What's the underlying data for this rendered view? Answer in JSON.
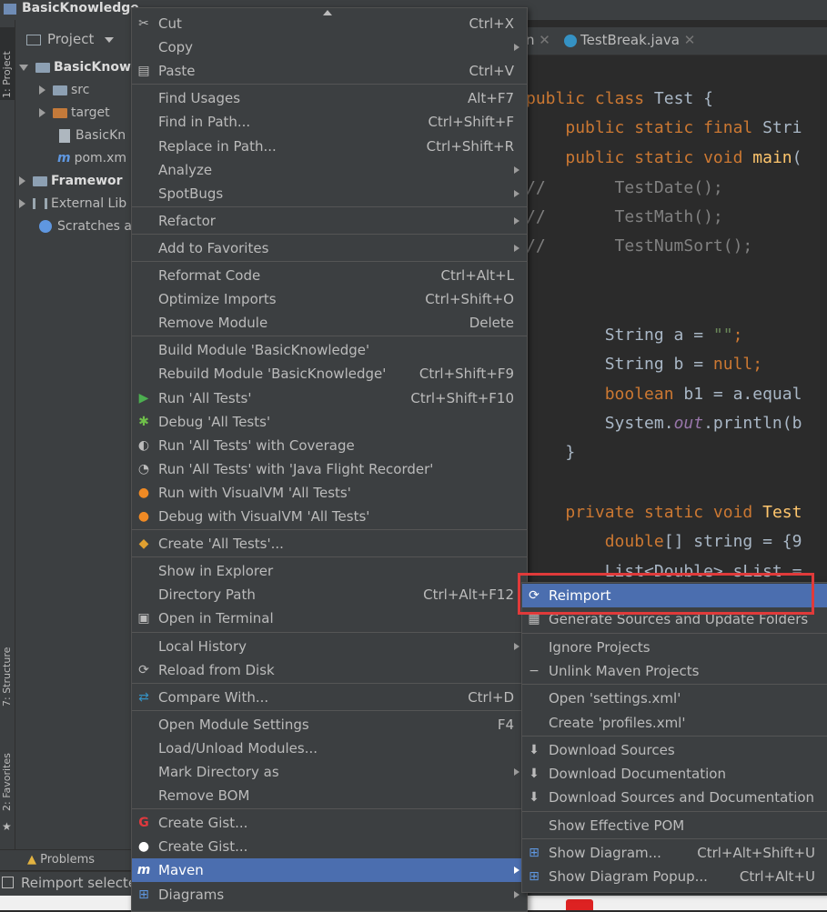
{
  "window": {
    "title": "BasicKnowledge"
  },
  "side_tabs": {
    "project": "1: Project",
    "structure": "7: Structure",
    "favorites": "2: Favorites"
  },
  "project_panel": {
    "header": "Project",
    "tree": [
      {
        "label": "BasicKnow",
        "level": 0,
        "expanded": true,
        "bold": true,
        "icon": "module-folder-icon"
      },
      {
        "label": "src",
        "level": 1,
        "icon": "folder-icon"
      },
      {
        "label": "target",
        "level": 1,
        "icon": "folder-orange-icon"
      },
      {
        "label": "BasicKn",
        "level": 1,
        "icon": "iml-file-icon"
      },
      {
        "label": "pom.xm",
        "level": 1,
        "icon": "maven-file-icon"
      },
      {
        "label": "Framewor",
        "level": 0,
        "bold": true,
        "icon": "module-folder-icon"
      },
      {
        "label": "External Lib",
        "level": 0,
        "icon": "libraries-icon"
      },
      {
        "label": "Scratches a",
        "level": 0,
        "icon": "scratches-icon"
      }
    ]
  },
  "editor": {
    "tabs": [
      {
        "label": "n"
      },
      {
        "label": "TestBreak.java"
      }
    ],
    "code": [
      "public class Test {",
      "    public static final Stri",
      "    public static void main(",
      "//       TestDate();",
      "//       TestMath();",
      "//       TestNumSort();",
      "",
      "",
      "        String a = \"\";",
      "        String b = null;",
      "        boolean b1 = a.equal",
      "        System.out.println(b",
      "    }",
      "",
      "    private static void Test",
      "        double[] string = {9",
      "        List<Double> sList ="
    ]
  },
  "bottom_tool": {
    "problems": "Problems"
  },
  "status_text": "Reimport selecte",
  "context_menu": {
    "items": [
      {
        "label": "Cut",
        "shortcut": "Ctrl+X",
        "icon": "scissors-icon"
      },
      {
        "label": "Copy",
        "submenu": true
      },
      {
        "label": "Paste",
        "shortcut": "Ctrl+V",
        "icon": "clipboard-icon"
      },
      {
        "sep": true
      },
      {
        "label": "Find Usages",
        "shortcut": "Alt+F7"
      },
      {
        "label": "Find in Path...",
        "shortcut": "Ctrl+Shift+F"
      },
      {
        "label": "Replace in Path...",
        "shortcut": "Ctrl+Shift+R"
      },
      {
        "label": "Analyze",
        "submenu": true
      },
      {
        "label": "SpotBugs",
        "submenu": true
      },
      {
        "sep": true
      },
      {
        "label": "Refactor",
        "submenu": true
      },
      {
        "sep": true
      },
      {
        "label": "Add to Favorites",
        "submenu": true
      },
      {
        "sep": true
      },
      {
        "label": "Reformat Code",
        "shortcut": "Ctrl+Alt+L"
      },
      {
        "label": "Optimize Imports",
        "shortcut": "Ctrl+Shift+O"
      },
      {
        "label": "Remove Module",
        "shortcut": "Delete"
      },
      {
        "sep": true
      },
      {
        "label": "Build Module 'BasicKnowledge'"
      },
      {
        "label": "Rebuild Module 'BasicKnowledge'",
        "shortcut": "Ctrl+Shift+F9"
      },
      {
        "label": "Run 'All Tests'",
        "shortcut": "Ctrl+Shift+F10",
        "icon": "run-icon"
      },
      {
        "label": "Debug 'All Tests'",
        "icon": "debug-icon"
      },
      {
        "label": "Run 'All Tests' with Coverage",
        "icon": "coverage-icon"
      },
      {
        "label": "Run 'All Tests' with 'Java Flight Recorder'",
        "icon": "profiler-icon"
      },
      {
        "label": "Run with VisualVM 'All Tests'",
        "icon": "visualvm-run-icon"
      },
      {
        "label": "Debug with VisualVM 'All Tests'",
        "icon": "visualvm-debug-icon"
      },
      {
        "sep": true
      },
      {
        "label": "Create 'All Tests'...",
        "icon": "create-config-icon"
      },
      {
        "sep": true
      },
      {
        "label": "Show in Explorer"
      },
      {
        "label": "Directory Path",
        "shortcut": "Ctrl+Alt+F12"
      },
      {
        "label": "Open in Terminal",
        "icon": "terminal-icon"
      },
      {
        "sep": true
      },
      {
        "label": "Local History",
        "submenu": true
      },
      {
        "label": "Reload from Disk",
        "icon": "reload-icon"
      },
      {
        "sep": true
      },
      {
        "label": "Compare With...",
        "shortcut": "Ctrl+D",
        "icon": "compare-icon"
      },
      {
        "sep": true
      },
      {
        "label": "Open Module Settings",
        "shortcut": "F4"
      },
      {
        "label": "Load/Unload Modules..."
      },
      {
        "label": "Mark Directory as",
        "submenu": true
      },
      {
        "label": "Remove BOM"
      },
      {
        "sep": true
      },
      {
        "label": "Create Gist...",
        "icon": "gist-red-icon"
      },
      {
        "label": "Create Gist...",
        "icon": "github-icon"
      },
      {
        "label": "Maven",
        "submenu": true,
        "selected": true,
        "icon": "maven-icon"
      },
      {
        "label": "Diagrams",
        "submenu": true,
        "icon": "diagram-icon"
      }
    ]
  },
  "maven_submenu": {
    "items": [
      {
        "label": "Reimport",
        "selected": true,
        "icon": "reimport-icon"
      },
      {
        "label": "Generate Sources and Update Folders",
        "icon": "generate-sources-icon"
      },
      {
        "sep": true
      },
      {
        "label": "Ignore Projects"
      },
      {
        "label": "Unlink Maven Projects",
        "icon": "minus-icon"
      },
      {
        "sep": true
      },
      {
        "label": "Open 'settings.xml'"
      },
      {
        "label": "Create 'profiles.xml'"
      },
      {
        "sep": true
      },
      {
        "label": "Download Sources",
        "icon": "download-icon"
      },
      {
        "label": "Download Documentation",
        "icon": "download-icon"
      },
      {
        "label": "Download Sources and Documentation",
        "icon": "download-icon"
      },
      {
        "sep": true
      },
      {
        "label": "Show Effective POM"
      },
      {
        "sep": true
      },
      {
        "label": "Show Diagram...",
        "shortcut": "Ctrl+Alt+Shift+U",
        "icon": "diagram-icon"
      },
      {
        "label": "Show Diagram Popup...",
        "shortcut": "Ctrl+Alt+U",
        "icon": "diagram-icon"
      }
    ]
  },
  "colors": {
    "selection": "#4b6eaf",
    "menu_bg": "#3c3f41",
    "highlight_box": "#e03a3a"
  }
}
